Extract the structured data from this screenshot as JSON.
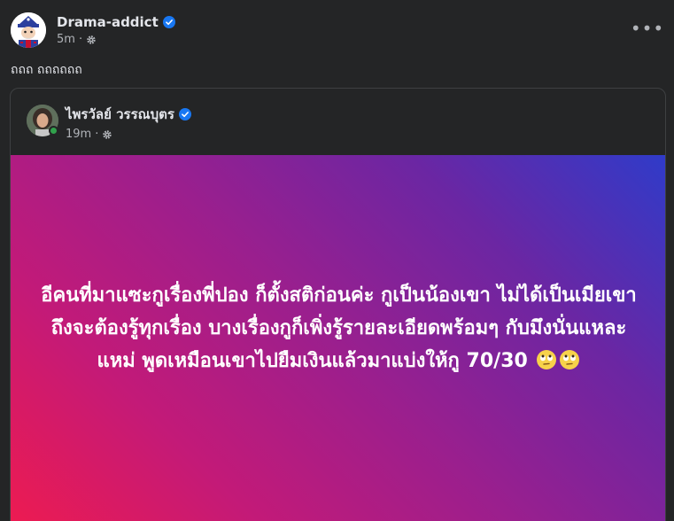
{
  "post": {
    "author": "Drama-addict",
    "time": "5m",
    "privacy_icon": "gear-icon",
    "text": "ถถถ ถถถถถถ",
    "more_icon": "•••"
  },
  "shared_post": {
    "author": "ไพรวัลย์ วรรณบุตร",
    "time": "19m",
    "privacy_icon": "gear-icon",
    "status": "online",
    "body": "อีคนที่มาแซะกูเรื่องพี่ปอง ก็ตั้งสติก่อนค่ะ กูเป็นน้องเขา ไม่ได้เป็นเมียเขา ถึงจะต้องรู้ทุกเรื่อง บางเรื่องกูก็เพิ่งรู้รายละเอียดพร้อมๆ กับมึงนั่นแหละ แหม่ พูดเหมือนเขาไปยืมเงินแล้วมาแบ่งให้กู 70/30",
    "emojis": [
      "rolling-eyes-emoji",
      "rolling-eyes-emoji"
    ]
  },
  "colors": {
    "background": "#242526",
    "verified": "#1877f2",
    "gradient_start": "#ee1b50",
    "gradient_end": "#2f3bc9",
    "online": "#31a24c"
  }
}
